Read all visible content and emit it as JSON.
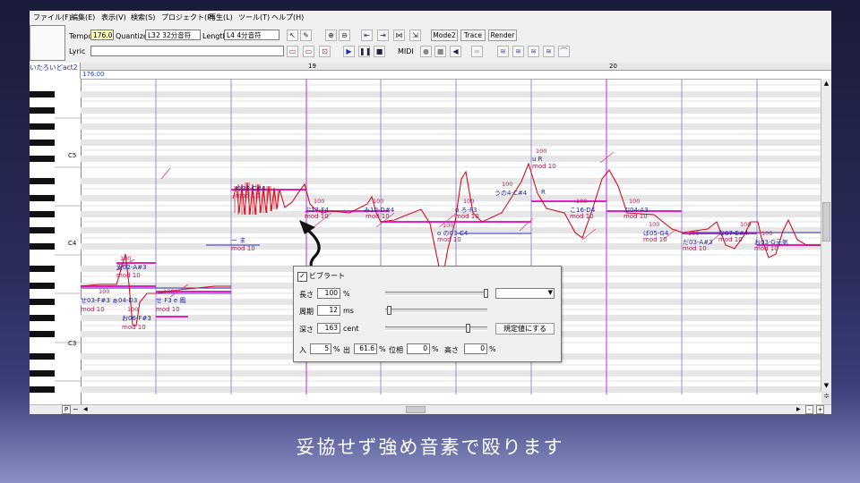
{
  "menu": [
    "ファイル(F)",
    "編集(E)",
    "表示(V)",
    "検索(S)",
    "プロジェクト(P)",
    "再生(L)",
    "ツール(T)",
    "ヘルプ(H)"
  ],
  "toolbar": {
    "tempo_label": "Tempo",
    "tempo_value": "176.0",
    "quantize_label": "Quantize",
    "quantize_value": "L32 32分音符",
    "length_label": "Length",
    "length_value": "L4  4分音符",
    "mode_label": "Mode2",
    "trace_label": "Trace",
    "render_label": "Render",
    "lyric_label": "Lyric",
    "lyric_value": "",
    "midi_label": "MIDI"
  },
  "track": {
    "name": "いたろいどact2",
    "tempo_marker": "176.00"
  },
  "ruler": {
    "measure_a": "19",
    "measure_b": "20"
  },
  "keys": {
    "c5": "C5",
    "c4": "C4",
    "c3": "C3"
  },
  "notes": [
    {
      "lyric": "ゆ32-C#4",
      "velocity": "100",
      "mod": "mod 10"
    },
    {
      "lyric": "ぷ17-F4",
      "velocity": "100",
      "mod": "mod 10"
    },
    {
      "lyric": "み10-D#4",
      "velocity": "100",
      "mod": "mod 10"
    },
    {
      "lyric": "o ろ-F3",
      "velocity": "100",
      "mod": "mod 10"
    },
    {
      "lyric": "o の03-C4",
      "velocity": "100",
      "mod": "mod 10"
    },
    {
      "lyric": "うの4-C#4",
      "velocity": "100",
      "mod": ""
    },
    {
      "lyric": "R",
      "velocity": "",
      "mod": ""
    },
    {
      "lyric": "u R",
      "velocity": "100",
      "mod": "mod 10"
    },
    {
      "lyric": "こ16-D4",
      "velocity": "100",
      "mod": "mod 10"
    },
    {
      "lyric": "ぷ04-A3",
      "velocity": "100",
      "mod": "mod 10"
    },
    {
      "lyric": "ば05-G4",
      "velocity": "100",
      "mod": "mod 10"
    },
    {
      "lyric": "だ03-A#3",
      "velocity": "100",
      "mod": "mod 10"
    },
    {
      "lyric": "な07-E#4",
      "velocity": "100",
      "mod": "mod 10"
    },
    {
      "lyric": "お03-G元気",
      "velocity": "100",
      "mod": "mod 10"
    },
    {
      "lyric": "ー ま",
      "velocity": "",
      "mod": "mod 10"
    },
    {
      "lyric": "愛02-A#3",
      "velocity": "100",
      "mod": "mod 10"
    },
    {
      "lyric": "せ03-F#3 ぁ04-D3",
      "velocity": "100",
      "mod": "mod 10"
    },
    {
      "lyric": "お06-F#3",
      "velocity": "100",
      "mod": "mod 10"
    },
    {
      "lyric": "せ F3 e 鳳",
      "velocity": "100",
      "mod": "mod 10"
    }
  ],
  "dialog": {
    "vibrato_label": "ビブラート",
    "vibrato_checked": true,
    "length_label": "長さ",
    "length_value": "100",
    "length_unit": "%",
    "period_label": "周期",
    "period_value": "12",
    "period_unit": "ms",
    "depth_label": "深さ",
    "depth_value": "163",
    "depth_unit": "cent",
    "default_button": "規定値にする",
    "in_label": "入",
    "in_value": "5",
    "in_unit": "%",
    "out_label": "出",
    "out_value": "61.6",
    "out_unit": "%",
    "phase_label": "位相",
    "phase_value": "0",
    "phase_unit": "%",
    "height_label": "高さ",
    "height_value": "0",
    "height_unit": "%"
  },
  "scroll": {
    "part_label": "P",
    "minus": "-",
    "plus": "+"
  },
  "caption": "妥協せず強め音素で殴ります",
  "colors": {
    "note_bar": "#e020c8",
    "pitch_line": "#d01020",
    "lyric_text": "#2020a0",
    "mod_text": "#c01040",
    "measure_line": "#a040d0"
  }
}
